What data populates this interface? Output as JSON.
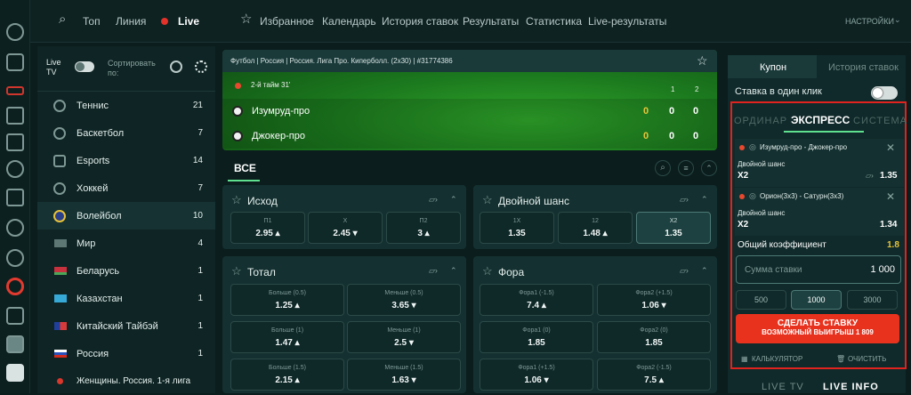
{
  "nav": {
    "left": [
      "Топ",
      "Линия",
      "Live"
    ],
    "links": [
      "Избранное",
      "Календарь",
      "История ставок",
      "Результаты",
      "Статистика",
      "Live-результаты"
    ],
    "settings": "НАСТРОЙКИ"
  },
  "sidebar": {
    "live_tv": "Live\nTV",
    "sort": "Сортировать\nпо:",
    "items": [
      {
        "name": "Теннис",
        "count": "21",
        "icon": "tennis-icon"
      },
      {
        "name": "Баскетбол",
        "count": "7",
        "icon": "basketball-icon"
      },
      {
        "name": "Esports",
        "count": "14",
        "icon": "gamepad-icon"
      },
      {
        "name": "Хоккей",
        "count": "7",
        "icon": "hockey-icon"
      },
      {
        "name": "Волейбол",
        "count": "10",
        "icon": "volleyball-icon"
      },
      {
        "name": "Мир",
        "count": "4",
        "icon": "world-flag"
      },
      {
        "name": "Беларусь",
        "count": "1",
        "icon": "belarus-flag"
      },
      {
        "name": "Казахстан",
        "count": "1",
        "icon": "kazakhstan-flag"
      },
      {
        "name": "Китайский Тайбэй",
        "count": "1",
        "icon": "taiwan-flag"
      },
      {
        "name": "Россия",
        "count": "1",
        "icon": "russia-flag"
      },
      {
        "name": "Женщины. Россия. 1-я лига",
        "count": "",
        "icon": "live-dot"
      }
    ]
  },
  "match": {
    "breadcrumb": "Футбол | Россия | Россия. Лига Про. Киперболл. (2x30) | #31774386",
    "period": "2-й тайм 31'",
    "col1": "1",
    "col2": "2",
    "teams": [
      {
        "name": "Изумруд-про",
        "score": "0",
        "p1": "0",
        "p2": "0"
      },
      {
        "name": "Джокер-про",
        "score": "0",
        "p1": "0",
        "p2": "0"
      }
    ]
  },
  "tabs": {
    "all": "ВСЕ"
  },
  "markets": [
    {
      "title": "Исход",
      "odds": [
        {
          "label": "П1",
          "value": "2.95",
          "dir": "up"
        },
        {
          "label": "X",
          "value": "2.45",
          "dir": "down"
        },
        {
          "label": "П2",
          "value": "3",
          "dir": "up"
        }
      ]
    },
    {
      "title": "Двойной шанс",
      "odds": [
        {
          "label": "1X",
          "value": "1.35",
          "dir": ""
        },
        {
          "label": "12",
          "value": "1.48",
          "dir": "up"
        },
        {
          "label": "X2",
          "value": "1.35",
          "dir": ""
        }
      ]
    },
    {
      "title": "Тотал",
      "odds": [
        {
          "label": "Больше (0.5)",
          "value": "1.25",
          "dir": "up"
        },
        {
          "label": "Меньше (0.5)",
          "value": "3.65",
          "dir": "down"
        },
        {
          "label": "Больше (1)",
          "value": "1.47",
          "dir": "up"
        },
        {
          "label": "Меньше (1)",
          "value": "2.5",
          "dir": "down"
        },
        {
          "label": "Больше (1.5)",
          "value": "2.15",
          "dir": "up"
        },
        {
          "label": "Меньше (1.5)",
          "value": "1.63",
          "dir": "down"
        }
      ]
    },
    {
      "title": "Фора",
      "odds": [
        {
          "label": "Фора1 (-1.5)",
          "value": "7.4",
          "dir": "up"
        },
        {
          "label": "Фора2 (+1.5)",
          "value": "1.06",
          "dir": "down"
        },
        {
          "label": "Фора1 (0)",
          "value": "1.85",
          "dir": ""
        },
        {
          "label": "Фора2 (0)",
          "value": "1.85",
          "dir": ""
        },
        {
          "label": "Фора1 (+1.5)",
          "value": "1.06",
          "dir": "down"
        },
        {
          "label": "Фора2 (-1.5)",
          "value": "7.5",
          "dir": "up"
        }
      ]
    }
  ],
  "coupon": {
    "tab1": "Купон",
    "tab2": "История ставок",
    "oneclick": "Ставка в один клик",
    "types": [
      "ОРДИНАР",
      "ЭКСПРЕСС",
      "СИСТЕМА"
    ],
    "bets": [
      {
        "event": "Изумруд-про - Джокер-про",
        "market": "Двойной шанс",
        "pick": "X2",
        "odd": "1.35"
      },
      {
        "event": "Орион(3x3) - Сатурн(3x3)",
        "market": "Двойной шанс",
        "pick": "X2",
        "odd": "1.34"
      }
    ],
    "total_label": "Общий коэффициент",
    "total_value": "1.8",
    "stake_placeholder": "Сумма ставки",
    "stake_value": "1 000",
    "quick": [
      "500",
      "1000",
      "3000"
    ],
    "bet_button": "СДЕЛАТЬ СТАВКУ",
    "win_text": "ВОЗМОЖНЫЙ ВЫИГРЫШ 1 809",
    "calc": "КАЛЬКУЛЯТОР",
    "clear": "ОЧИСТИТЬ"
  },
  "bottom_tabs": [
    "LIVE TV",
    "LIVE INFO"
  ],
  "colors": {
    "accent_green": "#5fe08f",
    "down_red": "#ff5a4a",
    "bet_button": "#e8321e",
    "coupon_border": "#e0231e",
    "total_yellow": "#e8c53a"
  }
}
